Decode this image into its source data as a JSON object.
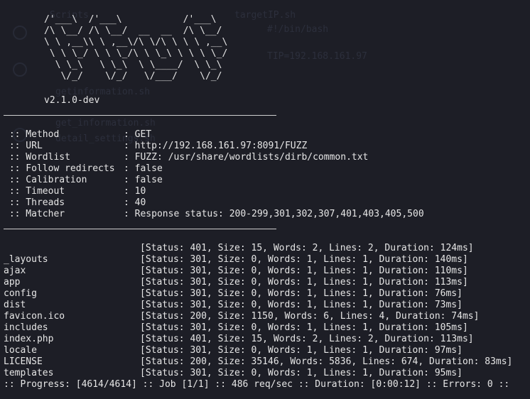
{
  "banner_art": "/'___\\  /'___\\           /'___\\\n/\\ \\__/ /\\ \\__/  __  __  /\\ \\__/\n\\ \\ ,__\\\\ \\ ,__\\/\\ \\/\\ \\ \\ \\ ,__\\\n \\ \\ \\_/ \\ \\ \\_/\\ \\ \\_\\ \\ \\ \\ \\_/\n  \\ \\_\\   \\ \\_\\  \\ \\____/  \\ \\_\\\n   \\/_/    \\/_/   \\/___/    \\/_/",
  "version": "v2.1.0-dev",
  "config": [
    {
      "key": " :: Method           ",
      "value": ": GET"
    },
    {
      "key": " :: URL              ",
      "value": ": http://192.168.161.97:8091/FUZZ"
    },
    {
      "key": " :: Wordlist         ",
      "value": ": FUZZ: /usr/share/wordlists/dirb/common.txt"
    },
    {
      "key": " :: Follow redirects ",
      "value": ": false"
    },
    {
      "key": " :: Calibration      ",
      "value": ": false"
    },
    {
      "key": " :: Timeout          ",
      "value": ": 10"
    },
    {
      "key": " :: Threads          ",
      "value": ": 40"
    },
    {
      "key": " :: Matcher          ",
      "value": ": Response status: 200-299,301,302,307,401,403,405,500"
    }
  ],
  "results": [
    {
      "name": "",
      "status": "[Status: 401, Size: 15, Words: 2, Lines: 2, Duration: 124ms]"
    },
    {
      "name": "_layouts",
      "status": "[Status: 301, Size: 0, Words: 1, Lines: 1, Duration: 140ms]"
    },
    {
      "name": "ajax",
      "status": "[Status: 301, Size: 0, Words: 1, Lines: 1, Duration: 110ms]"
    },
    {
      "name": "app",
      "status": "[Status: 301, Size: 0, Words: 1, Lines: 1, Duration: 113ms]"
    },
    {
      "name": "config",
      "status": "[Status: 301, Size: 0, Words: 1, Lines: 1, Duration: 76ms]"
    },
    {
      "name": "dist",
      "status": "[Status: 301, Size: 0, Words: 1, Lines: 1, Duration: 73ms]"
    },
    {
      "name": "favicon.ico",
      "status": "[Status: 200, Size: 1150, Words: 6, Lines: 4, Duration: 74ms]"
    },
    {
      "name": "includes",
      "status": "[Status: 301, Size: 0, Words: 1, Lines: 1, Duration: 105ms]"
    },
    {
      "name": "index.php",
      "status": "[Status: 401, Size: 15, Words: 2, Lines: 2, Duration: 113ms]"
    },
    {
      "name": "locale",
      "status": "[Status: 301, Size: 0, Words: 1, Lines: 1, Duration: 97ms]"
    },
    {
      "name": "LICENSE",
      "status": "[Status: 200, Size: 35146, Words: 5836, Lines: 674, Duration: 83ms]"
    },
    {
      "name": "templates",
      "status": "[Status: 301, Size: 0, Words: 1, Lines: 1, Duration: 95ms]"
    }
  ],
  "progress_line": ":: Progress: [4614/4614] :: Job [1/1] :: 486 req/sec :: Duration: [0:00:12] :: Errors: 0 ::",
  "ghost": {
    "title": "targetIP.sh",
    "line1": "#!/bin/bash",
    "line3": "TIP=192.168.161.97",
    "side1": "Scripts",
    "side2": "getinformation.sh",
    "side3": "get_information.sh",
    "side4": "detail_settings.sh"
  },
  "colors": {
    "background": "#1d1e26",
    "text": "#e6e6e6",
    "ghost": "#2c2f3c"
  }
}
